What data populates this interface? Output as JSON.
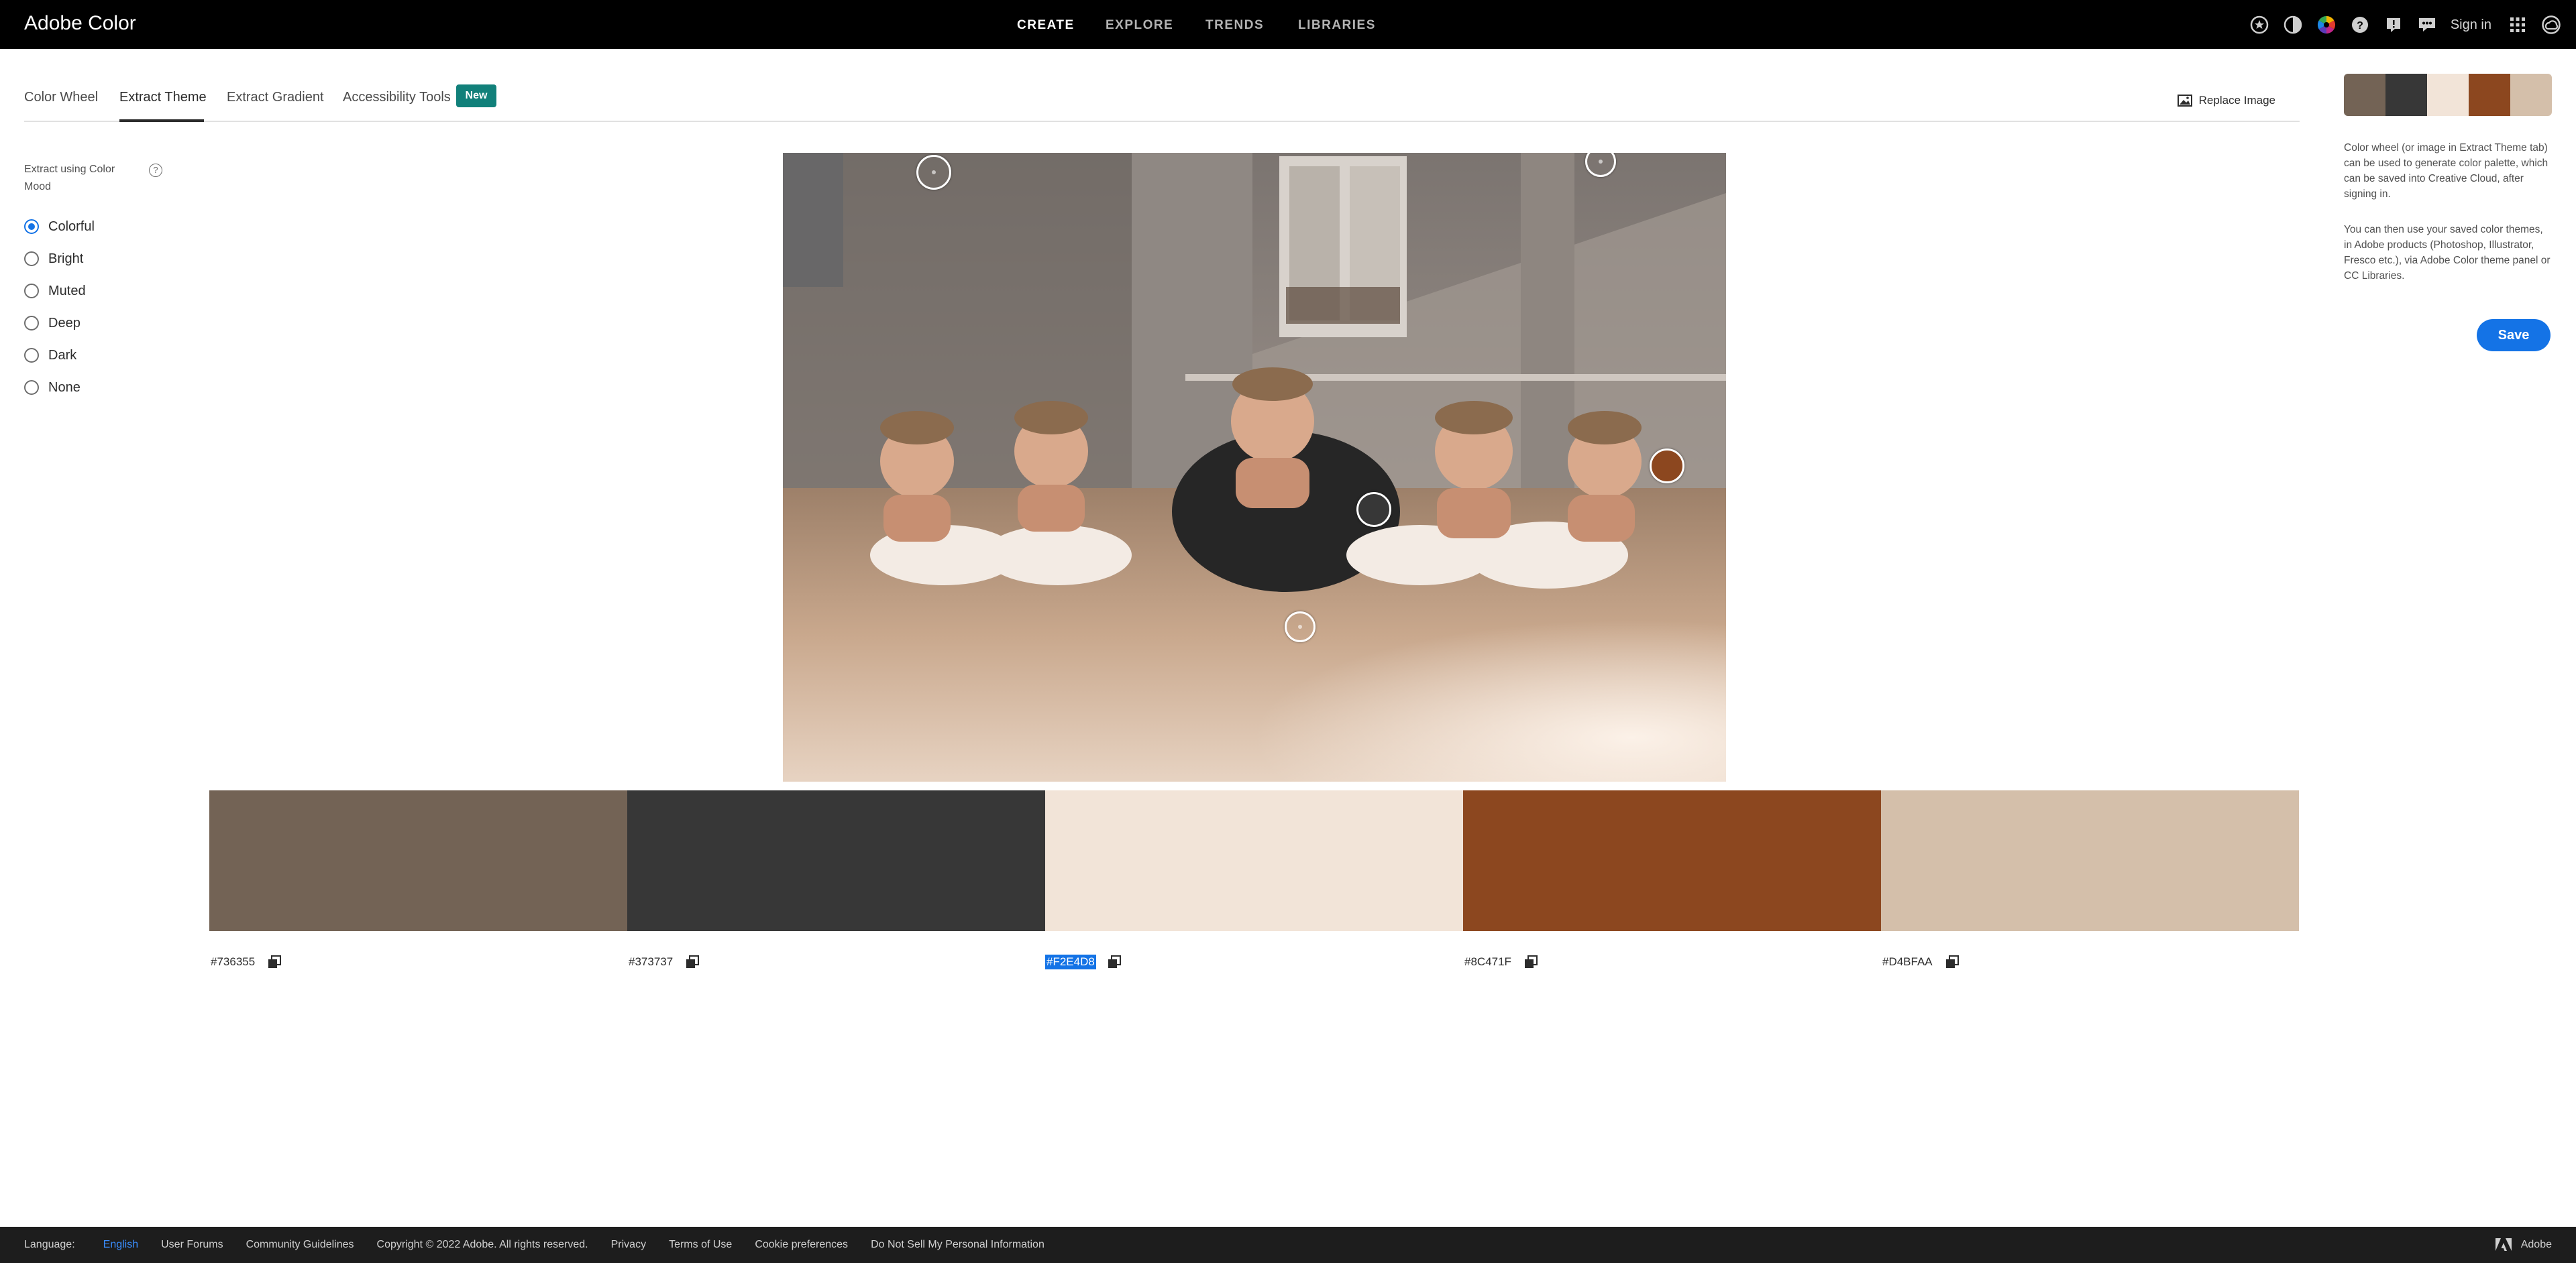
{
  "app": {
    "title": "Adobe Color"
  },
  "nav": {
    "items": [
      "CREATE",
      "EXPLORE",
      "TRENDS",
      "LIBRARIES"
    ],
    "active": "CREATE"
  },
  "header": {
    "signin": "Sign in"
  },
  "tabs": {
    "items": [
      "Color Wheel",
      "Extract Theme",
      "Extract Gradient",
      "Accessibility Tools"
    ],
    "active": "Extract Theme",
    "new_badge": "New",
    "replace_image": "Replace Image"
  },
  "left_panel": {
    "label": "Extract using Color Mood",
    "help": "?",
    "moods": [
      "Colorful",
      "Bright",
      "Muted",
      "Deep",
      "Dark",
      "None"
    ],
    "selected": "Colorful"
  },
  "palette": {
    "colors": [
      {
        "hex": "#736355",
        "color": "#736355"
      },
      {
        "hex": "#373737",
        "color": "#373737"
      },
      {
        "hex": "#F2E4D8",
        "color": "#F2E4D8",
        "selected": true
      },
      {
        "hex": "#8C471F",
        "color": "#8C471F"
      },
      {
        "hex": "#D4BFAA",
        "color": "#D4BFAA"
      }
    ]
  },
  "right_panel": {
    "info1": "Color wheel (or image in Extract Theme tab) can be used to generate color palette, which can be saved into Creative Cloud, after signing in.",
    "info2": "You can then use your saved color themes, in Adobe products (Photoshop, Illustrator, Fresco etc.), via Adobe Color theme panel or CC Libraries.",
    "save": "Save"
  },
  "footer": {
    "language_label": "Language:",
    "language_value": "English",
    "links": [
      "User Forums",
      "Community Guidelines",
      "Copyright © 2022 Adobe. All rights reserved.",
      "Privacy",
      "Terms of Use",
      "Cookie preferences",
      "Do Not Sell My Personal Information"
    ],
    "brand": "Adobe"
  },
  "icons": {
    "top": [
      "favorites-icon",
      "contrast-icon",
      "color-wheel-icon",
      "help-icon",
      "alert-icon",
      "feedback-icon",
      "apps-grid-icon",
      "creative-cloud-icon"
    ],
    "replace_image": "image-icon",
    "copy": "copy-icon"
  }
}
